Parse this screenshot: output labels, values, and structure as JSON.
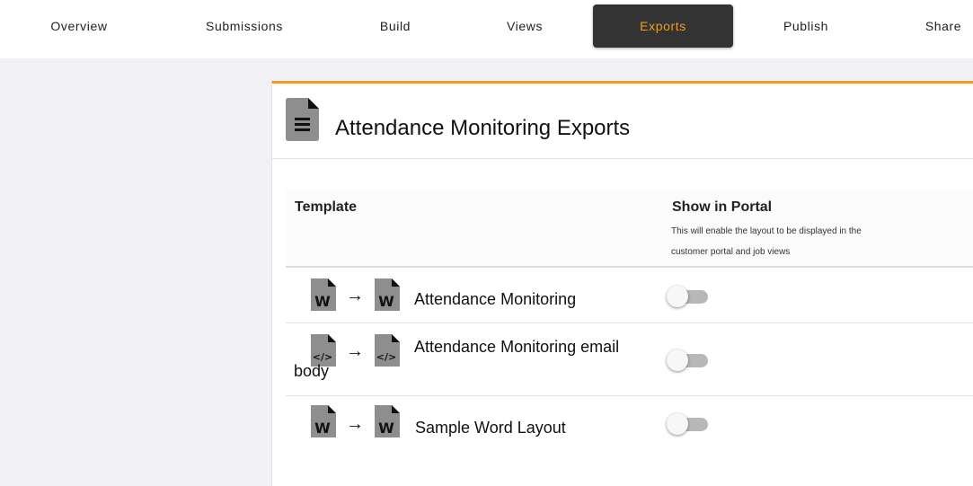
{
  "nav": {
    "tabs": [
      {
        "label": "Overview",
        "active": false
      },
      {
        "label": "Submissions",
        "active": false
      },
      {
        "label": "Build",
        "active": false
      },
      {
        "label": "Views",
        "active": false
      },
      {
        "label": "Exports",
        "active": true
      },
      {
        "label": "Publish",
        "active": false
      },
      {
        "label": "Share",
        "active": false
      }
    ]
  },
  "panel": {
    "title": "Attendance Monitoring Exports",
    "icon": "document-lines-icon"
  },
  "table": {
    "columns": {
      "template": "Template",
      "show_in_portal": "Show in Portal",
      "show_in_portal_desc": "This will enable the layout to be displayed in the customer portal and job views"
    },
    "rows": [
      {
        "source_icon": "word-file-icon",
        "source_letter": "W",
        "target_icon": "word-file-icon",
        "target_letter": "W",
        "name": "Attendance Monitoring",
        "show_in_portal": false
      },
      {
        "source_icon": "code-file-icon",
        "source_letter": "</>",
        "target_icon": "code-file-icon",
        "target_letter": "</>",
        "name": "Attendance Monitoring email body",
        "show_in_portal": false
      },
      {
        "source_icon": "word-file-icon",
        "source_letter": "W",
        "target_icon": "word-file-icon",
        "target_letter": "W",
        "name": "Sample Word Layout",
        "show_in_portal": false
      }
    ]
  },
  "colors": {
    "accent": "#f39c1e",
    "active_tab_bg": "#333333",
    "file_icon": "#8e8e8e"
  }
}
